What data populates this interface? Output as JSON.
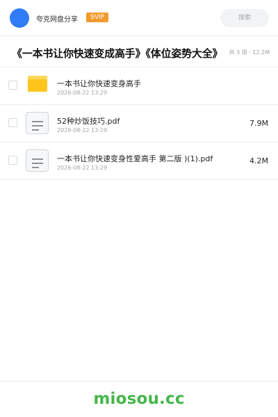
{
  "header": {
    "brand": "夸克网盘分享",
    "badge": "SVIP",
    "search_placeholder": "搜索",
    "accent_color": "#2f7cf6",
    "badge_color": "#f39a2d"
  },
  "share": {
    "title": "《一本书让你快速变成高手》《体位姿势大全》",
    "meta": "共 3 项 · 12.2M"
  },
  "files": [
    {
      "name": "一本书让你快速变身高手",
      "date": "2026-08-22 13:29",
      "size": "",
      "icon": "folder-icon"
    },
    {
      "name": "52种炒饭技巧.pdf",
      "date": "2026-08-22 13:29",
      "size": "7.9M",
      "icon": "document-icon"
    },
    {
      "name": "一本书让你快速变身性爱高手 第二版 )(1).pdf",
      "date": "2026-08-22 13:29",
      "size": "4.2M",
      "icon": "document-icon"
    }
  ],
  "footer": {
    "watermark": "miosou.cc",
    "watermark_color": "#45b64a"
  }
}
